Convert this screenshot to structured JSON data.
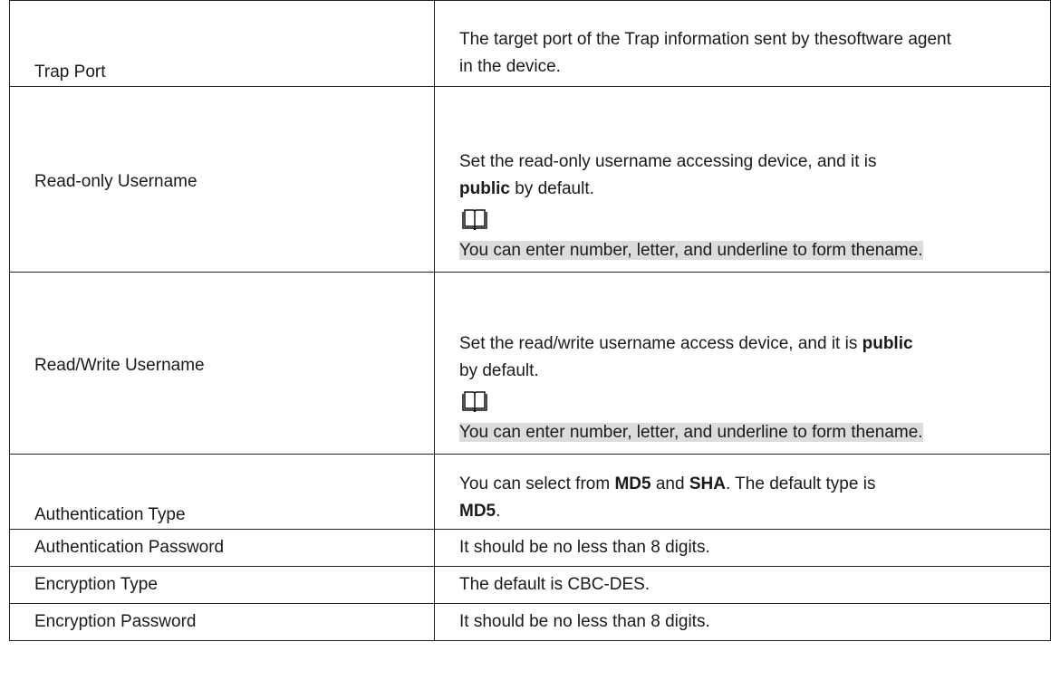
{
  "rows": [
    {
      "label": "Trap Port",
      "desc": {
        "line1": "The target port of the Trap information sent by thesoftware agent",
        "line2": "in the device."
      }
    },
    {
      "label": "Read-only Username",
      "desc": {
        "part1": "Set the read-only username accessing device, and it is",
        "bold": "public",
        "part2": " by default.",
        "note_icon": "book-icon",
        "note": "You can enter number, letter, and underline to form thename."
      }
    },
    {
      "label": "Read/Write Username",
      "desc": {
        "part1": "Set the read/write username access device, and it is ",
        "bold": "public",
        "part2": "by default.",
        "note_icon": "book-icon",
        "note": "You can enter number, letter, and underline to form thename."
      }
    },
    {
      "label": "Authentication Type",
      "desc": {
        "part1": "You can select from ",
        "bold1": "MD5",
        "part2": " and ",
        "bold2": "SHA",
        "part3": ". The default type is",
        "bold3": "MD5",
        "part4": "."
      }
    },
    {
      "label": "Authentication Password",
      "desc": "It should be no less than 8 digits."
    },
    {
      "label": "Encryption Type",
      "desc": "The default is CBC-DES."
    },
    {
      "label": "Encryption Password",
      "desc": "It should be no less than 8 digits."
    }
  ]
}
